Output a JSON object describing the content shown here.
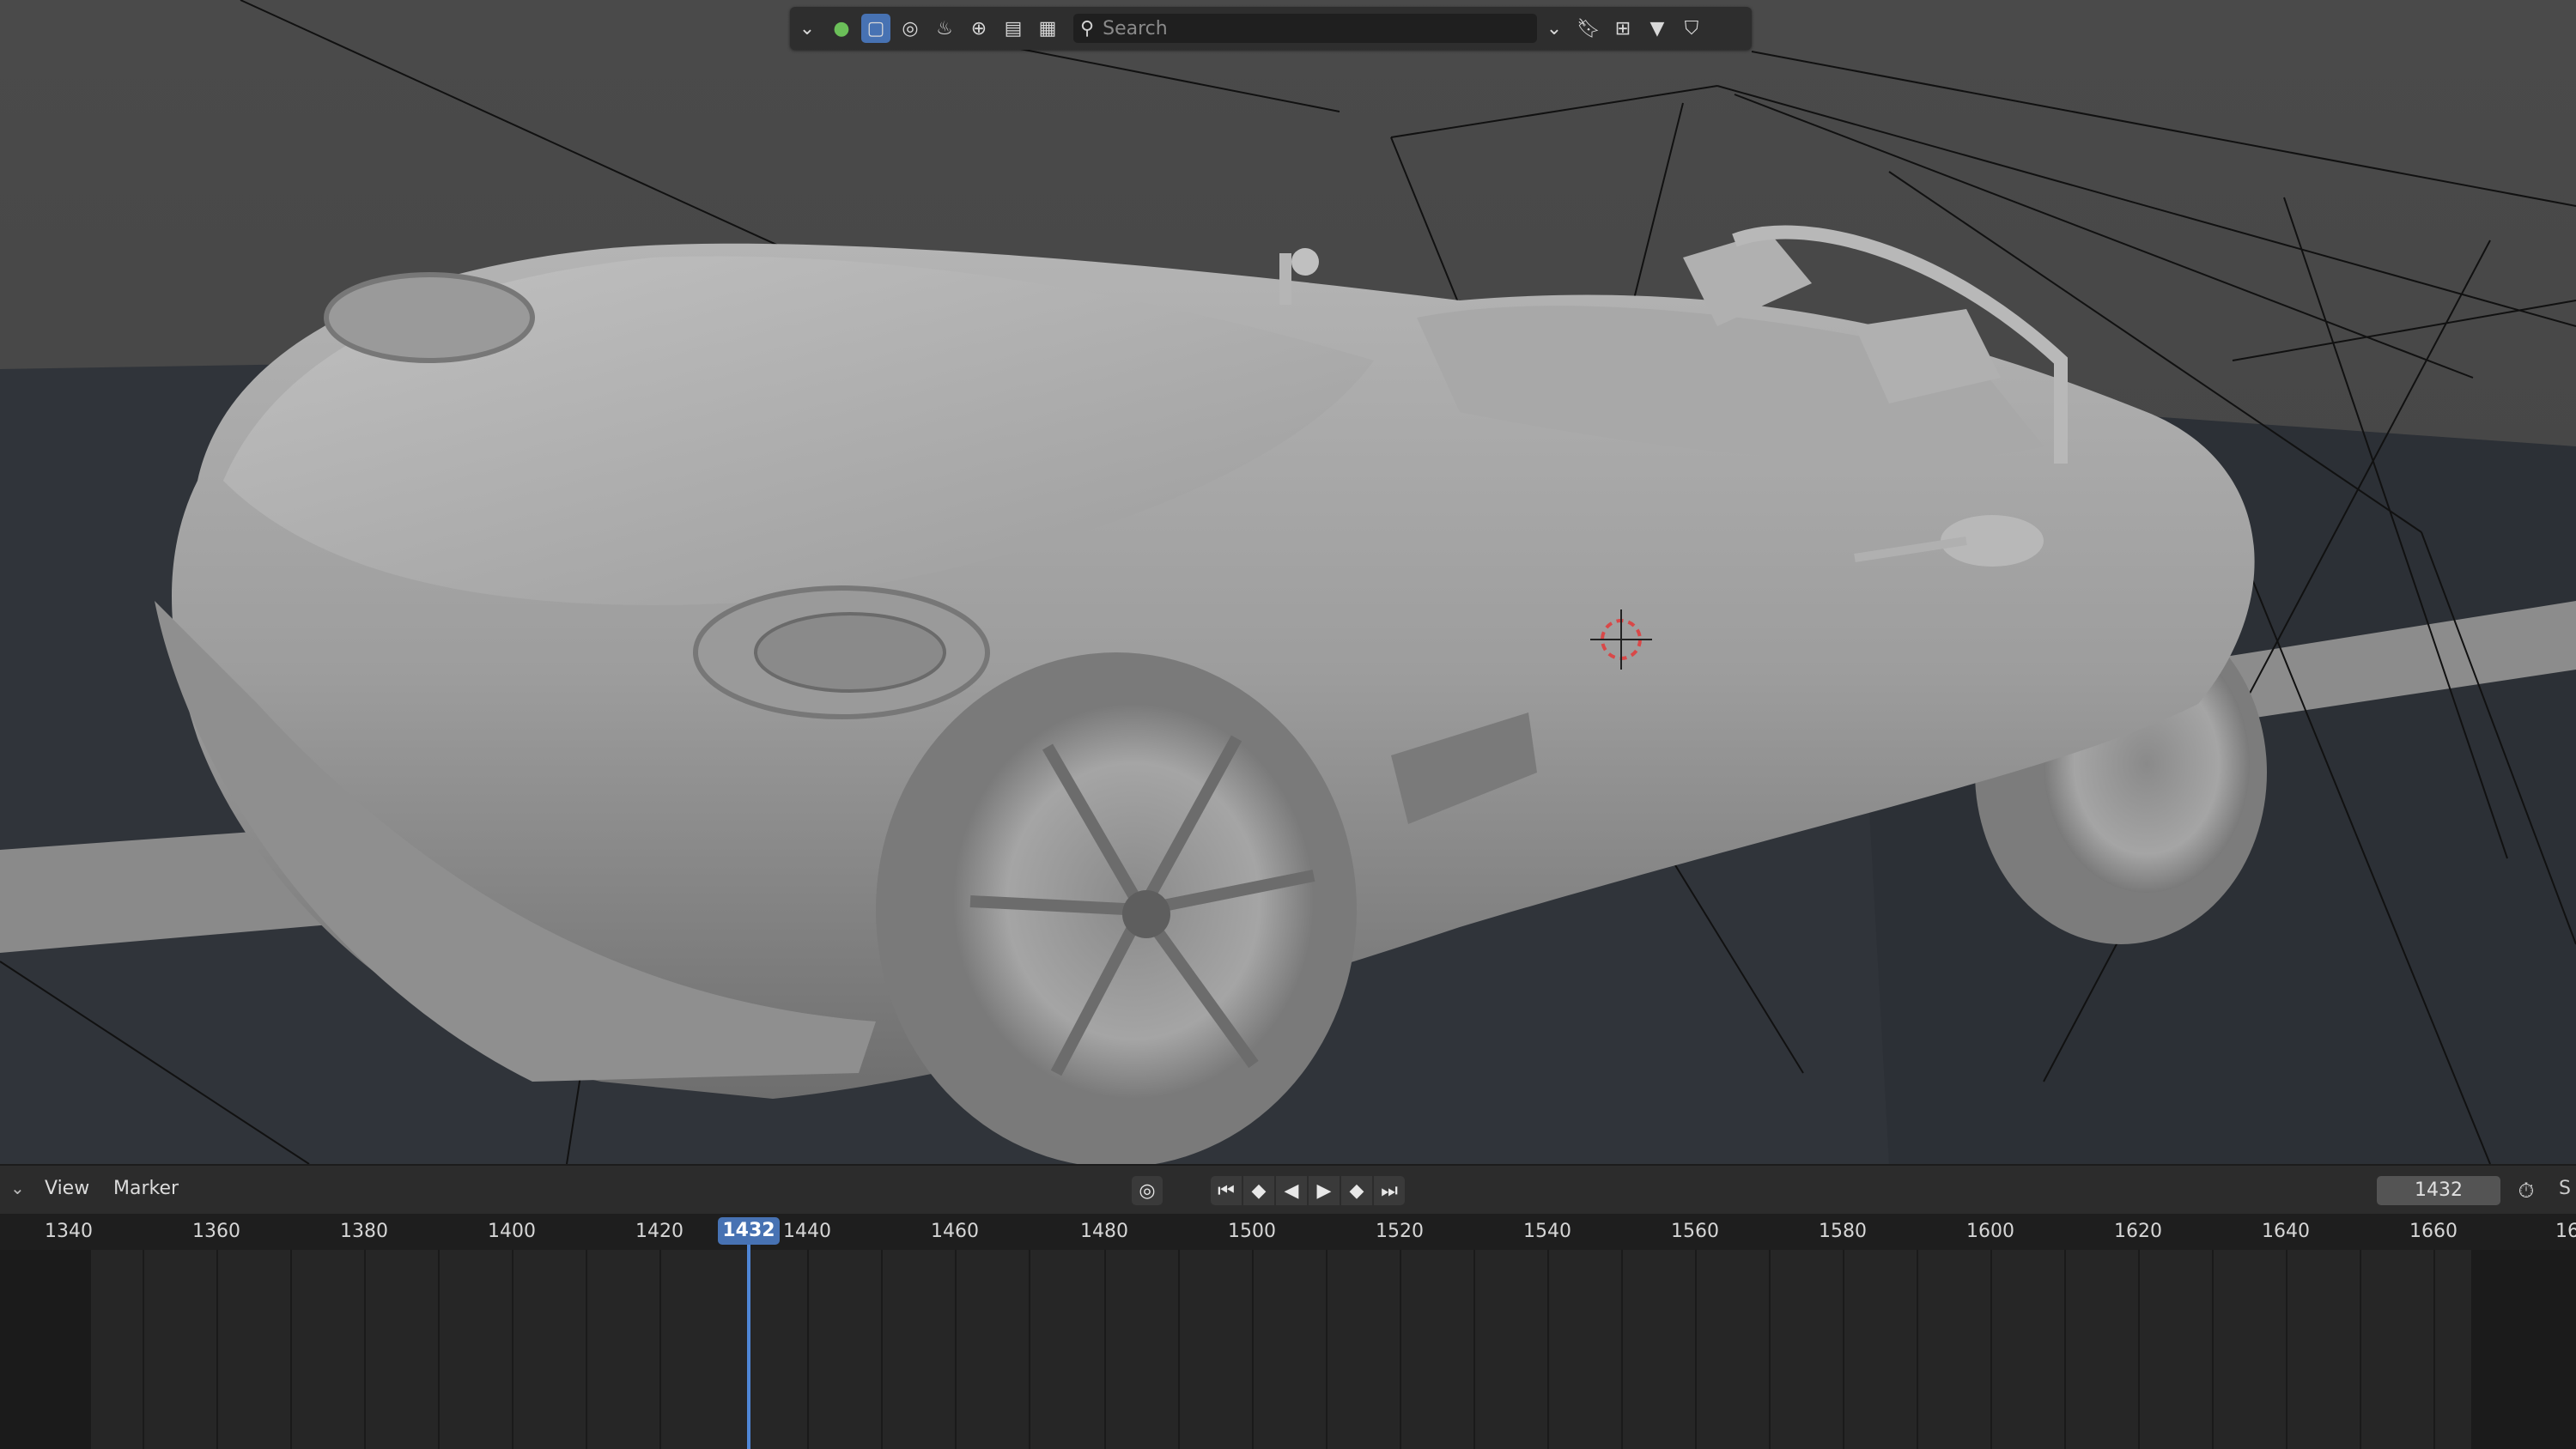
{
  "toolbar": {
    "search_placeholder": "Search"
  },
  "timeline": {
    "view_label": "View",
    "marker_label": "Marker",
    "current_frame": "1432",
    "current_frame_badge": "1432",
    "s_label": "S",
    "ruler_ticks": [
      "1340",
      "1360",
      "1380",
      "1400",
      "1420",
      "1440",
      "1460",
      "1480",
      "1500",
      "1520",
      "1540",
      "1560",
      "1580",
      "1600",
      "1620",
      "1640",
      "1660",
      "16"
    ]
  },
  "colors": {
    "accent": "#4772b3",
    "playhead": "#4f86d6"
  }
}
